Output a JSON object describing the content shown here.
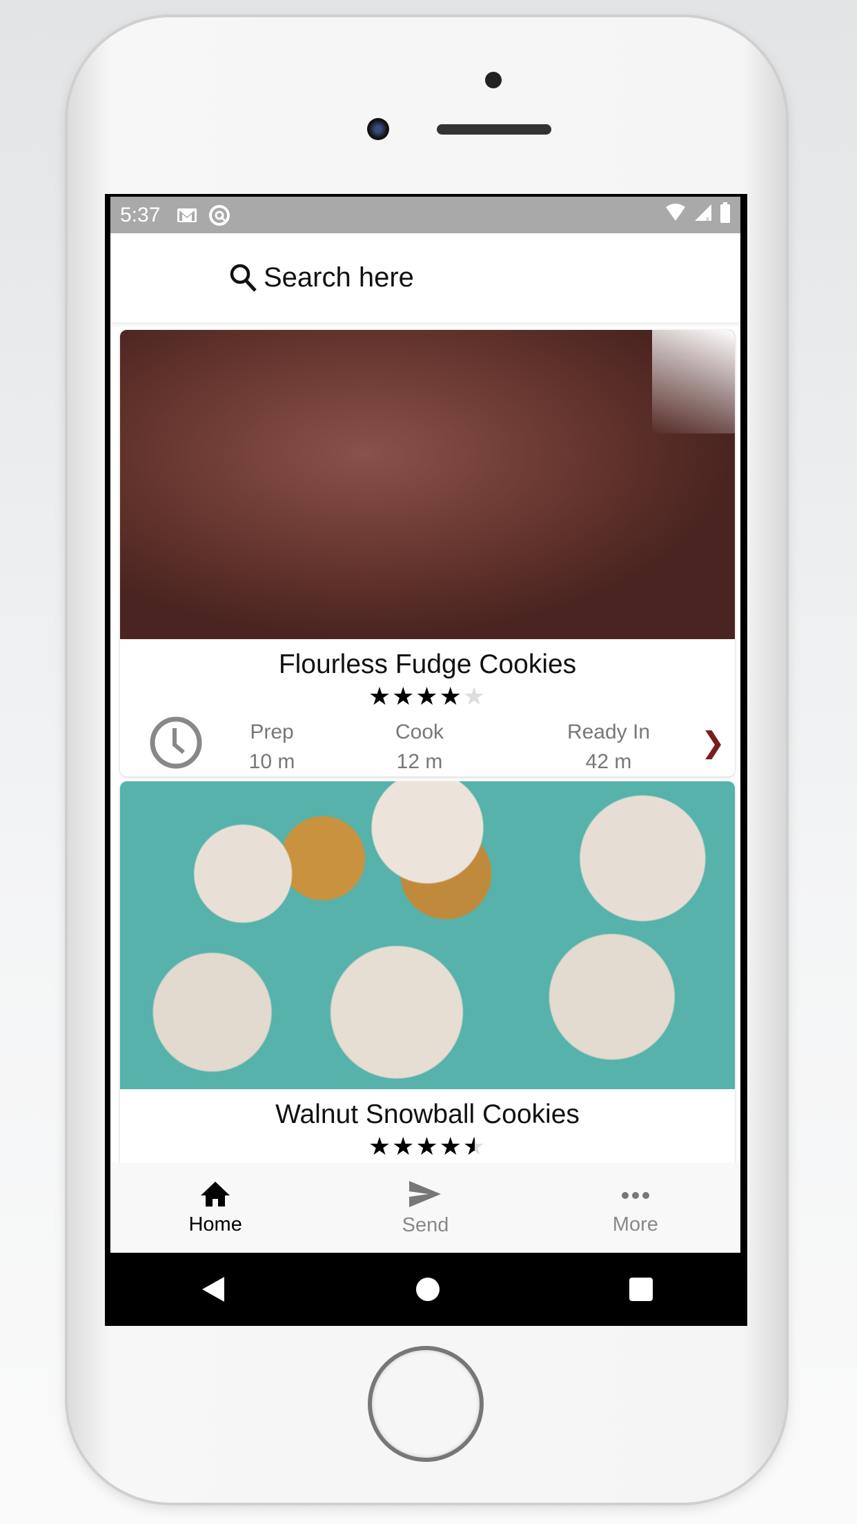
{
  "status_bar": {
    "time": "5:37",
    "icons": [
      "gmail-icon",
      "sync-icon",
      "wifi-icon",
      "signal-icon",
      "battery-icon"
    ]
  },
  "search": {
    "placeholder": "Search here"
  },
  "recipes": [
    {
      "title": "Flourless Fudge Cookies",
      "rating": 4,
      "max_rating": 5,
      "prep_label": "Prep",
      "prep": "10 m",
      "cook_label": "Cook",
      "cook": "12 m",
      "ready_label": "Ready In",
      "ready": "42 m"
    },
    {
      "title": "Walnut Snowball Cookies",
      "rating": 4.5,
      "max_rating": 5
    }
  ],
  "bottom_nav": [
    {
      "label": "Home",
      "icon": "home-icon",
      "active": true
    },
    {
      "label": "Send",
      "icon": "send-icon"
    },
    {
      "label": "More",
      "icon": "more-icon"
    }
  ],
  "colors": {
    "status_bar": "#a9a9a9",
    "chevron": "#7a1d1d"
  }
}
